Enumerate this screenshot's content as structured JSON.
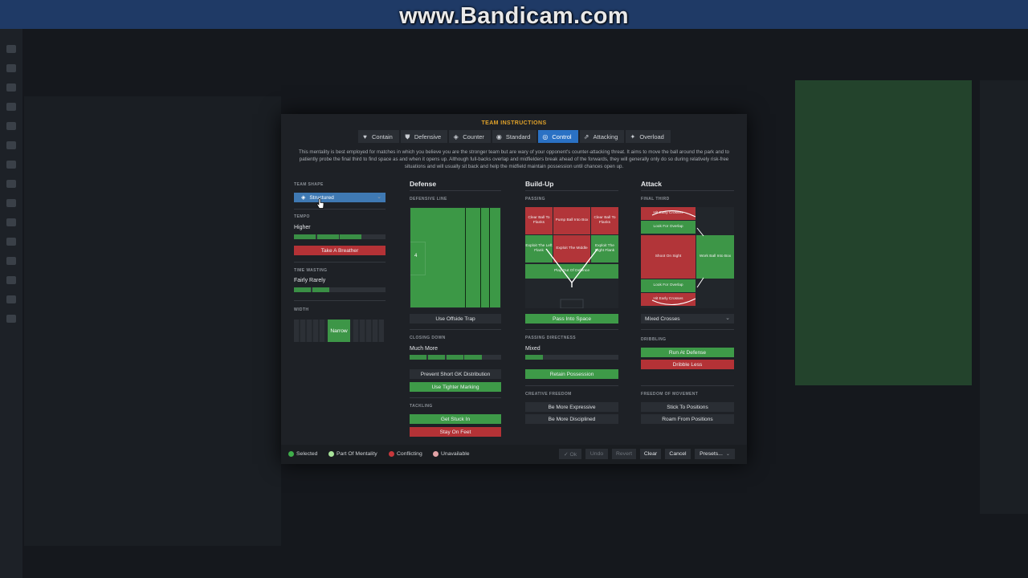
{
  "watermark": "www.Bandicam.com",
  "dialog": {
    "title": "TEAM INSTRUCTIONS",
    "tabs": [
      {
        "label": "Contain",
        "icon": "heart-icon"
      },
      {
        "label": "Defensive",
        "icon": "shield-icon"
      },
      {
        "label": "Counter",
        "icon": "counter-icon"
      },
      {
        "label": "Standard",
        "icon": "standard-icon"
      },
      {
        "label": "Control",
        "icon": "control-icon",
        "active": true
      },
      {
        "label": "Attacking",
        "icon": "attacking-icon"
      },
      {
        "label": "Overload",
        "icon": "overload-icon"
      }
    ],
    "description": "This mentality is best employed for matches in which you believe you are the stronger team but are wary of your opponent's counter-attacking threat. It aims to move the ball around the park and to patiently probe the final third to find space as and when it opens up. Although full-backs overlap and midfielders break ahead of the forwards, they will generally only do so during relatively risk-free situations and will usually sit back and help the midfield maintain possession until chances open up."
  },
  "left": {
    "team_shape_label": "TEAM SHAPE",
    "team_shape_value": "Structured",
    "tempo_label": "TEMPO",
    "tempo_value": "Higher",
    "tempo_level": 0.75,
    "take_breather": "Take A Breather",
    "time_wasting_label": "TIME WASTING",
    "time_wasting_value": "Fairly Rarely",
    "time_wasting_level": 0.4,
    "width_label": "WIDTH",
    "width_value": "Narrow"
  },
  "defense": {
    "header": "Defense",
    "line_label": "DEFENSIVE LINE",
    "line_number": "4",
    "offside_trap": "Use Offside Trap",
    "closing_label": "CLOSING DOWN",
    "closing_value": "Much More",
    "closing_level": 0.85,
    "prevent_gk": "Prevent Short GK Distribution",
    "tighter_marking": "Use Tighter Marking",
    "tackling_label": "TACKLING",
    "get_stuck_in": "Get Stuck In",
    "stay_on_feet": "Stay On Feet"
  },
  "buildup": {
    "header": "Build-Up",
    "passing_label": "PASSING",
    "cells": {
      "clear_left": "Clear Ball To Flanks",
      "pump_box": "Pump Ball Into Box",
      "clear_right": "Clear Ball To Flanks",
      "exploit_left": "Exploit The Left Flank",
      "exploit_middle": "Exploit The Middle",
      "exploit_right": "Exploit The Right Flank",
      "play_out": "Play Out Of Defence"
    },
    "pass_into_space": "Pass Into Space",
    "directness_label": "PASSING DIRECTNESS",
    "directness_value": "Mixed",
    "directness_level": 0.25,
    "retain_possession": "Retain Possession",
    "creative_label": "CREATIVE FREEDOM",
    "more_expressive": "Be More Expressive",
    "more_disciplined": "Be More Disciplined"
  },
  "attack": {
    "header": "Attack",
    "final_third_label": "FINAL THIRD",
    "cells": {
      "hit_early_top": "Hit Early Crosses",
      "overlap_top": "Look For Overlap",
      "shoot_on_sight": "Shoot On Sight",
      "work_into_box": "Work Ball Into Box",
      "overlap_bottom": "Look For Overlap",
      "hit_early_bottom": "Hit Early Crosses"
    },
    "crosses_value": "Mixed Crosses",
    "dribbling_label": "DRIBBLING",
    "run_at_defense": "Run At Defense",
    "dribble_less": "Dribble Less",
    "freedom_label": "FREEDOM OF MOVEMENT",
    "stick_to_positions": "Stick To Positions",
    "roam_from_positions": "Roam From Positions"
  },
  "footer": {
    "legend": [
      {
        "label": "Selected",
        "color": "#3fae4a"
      },
      {
        "label": "Part Of Mentality",
        "color": "#a8e39a"
      },
      {
        "label": "Conflicting",
        "color": "#c8383c"
      },
      {
        "label": "Unavailable",
        "color": "#e2a3a6"
      }
    ],
    "ok": "✓ Ok",
    "undo": "Undo",
    "revert": "Revert",
    "clear": "Clear",
    "cancel": "Cancel",
    "presets": "Presets..."
  }
}
